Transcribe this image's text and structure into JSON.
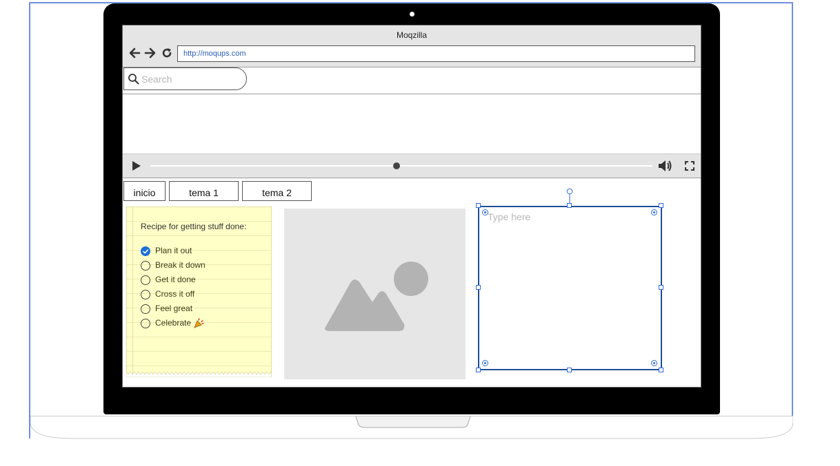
{
  "browser": {
    "title": "Moqzilla",
    "url": "http://moqups.com",
    "search_placeholder": "Search"
  },
  "video": {
    "progress": 0.49
  },
  "tabs": [
    {
      "label": "inicio"
    },
    {
      "label": "tema 1"
    },
    {
      "label": "tema 2"
    }
  ],
  "note": {
    "title": "Recipe for getting stuff done:",
    "items": [
      {
        "label": "Plan it out",
        "checked": true
      },
      {
        "label": "Break it down",
        "checked": false
      },
      {
        "label": "Get it done",
        "checked": false
      },
      {
        "label": "Cross it off",
        "checked": false
      },
      {
        "label": "Feel great",
        "checked": false
      },
      {
        "label": "Celebrate",
        "checked": false
      }
    ]
  },
  "textarea": {
    "placeholder": "Type here"
  },
  "colors": {
    "selection": "#2d6bd4",
    "checkbox_checked": "#1b6fd8",
    "note_bg": "#ffffc8"
  },
  "icons": [
    "back-arrow-icon",
    "forward-arrow-icon",
    "reload-icon",
    "search-icon",
    "play-icon",
    "volume-icon",
    "fullscreen-icon",
    "image-placeholder-icon",
    "party-popper-icon",
    "rotate-handle-icon"
  ]
}
